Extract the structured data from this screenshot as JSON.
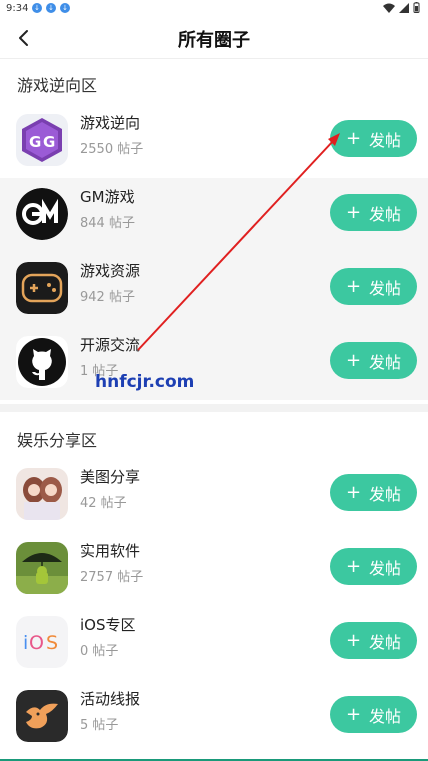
{
  "status_bar": {
    "time": "9:34"
  },
  "header": {
    "title": "所有圈子"
  },
  "sections": [
    {
      "title": "游戏逆向区",
      "items": [
        {
          "name": "游戏逆向",
          "count": "2550 帖子"
        },
        {
          "name": "GM游戏",
          "count": "844 帖子"
        },
        {
          "name": "游戏资源",
          "count": "942 帖子"
        },
        {
          "name": "开源交流",
          "count": "1 帖子"
        }
      ]
    },
    {
      "title": "娱乐分享区",
      "items": [
        {
          "name": "美图分享",
          "count": "42 帖子"
        },
        {
          "name": "实用软件",
          "count": "2757 帖子"
        },
        {
          "name": "iOS专区",
          "count": "0 帖子"
        },
        {
          "name": "活动线报",
          "count": "5 帖子"
        }
      ]
    }
  ],
  "post_button_label": "发帖",
  "watermark": "hnfcjr.com",
  "colors": {
    "accent": "#3cc8a0",
    "arrow": "#e02020"
  }
}
